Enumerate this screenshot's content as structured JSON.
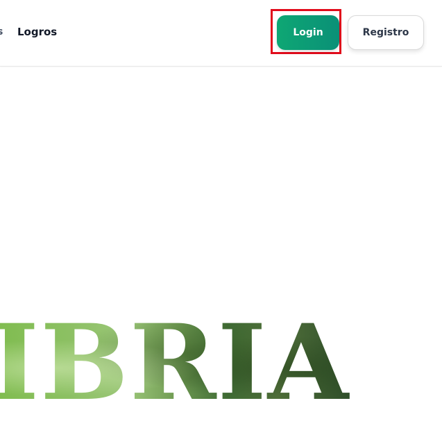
{
  "nav": {
    "cut_item_fragment": "s",
    "items": [
      {
        "label": "Logros"
      }
    ]
  },
  "auth": {
    "login_label": "Login",
    "register_label": "Registro"
  },
  "hero": {
    "word_fragment": "IBRIA"
  },
  "colors": {
    "login_button": "#0ea774",
    "highlight_frame": "#e10b1b",
    "register_text": "#2d3748",
    "hero_green_light": "#8cc063",
    "hero_green_dark": "#2f4f2a"
  }
}
